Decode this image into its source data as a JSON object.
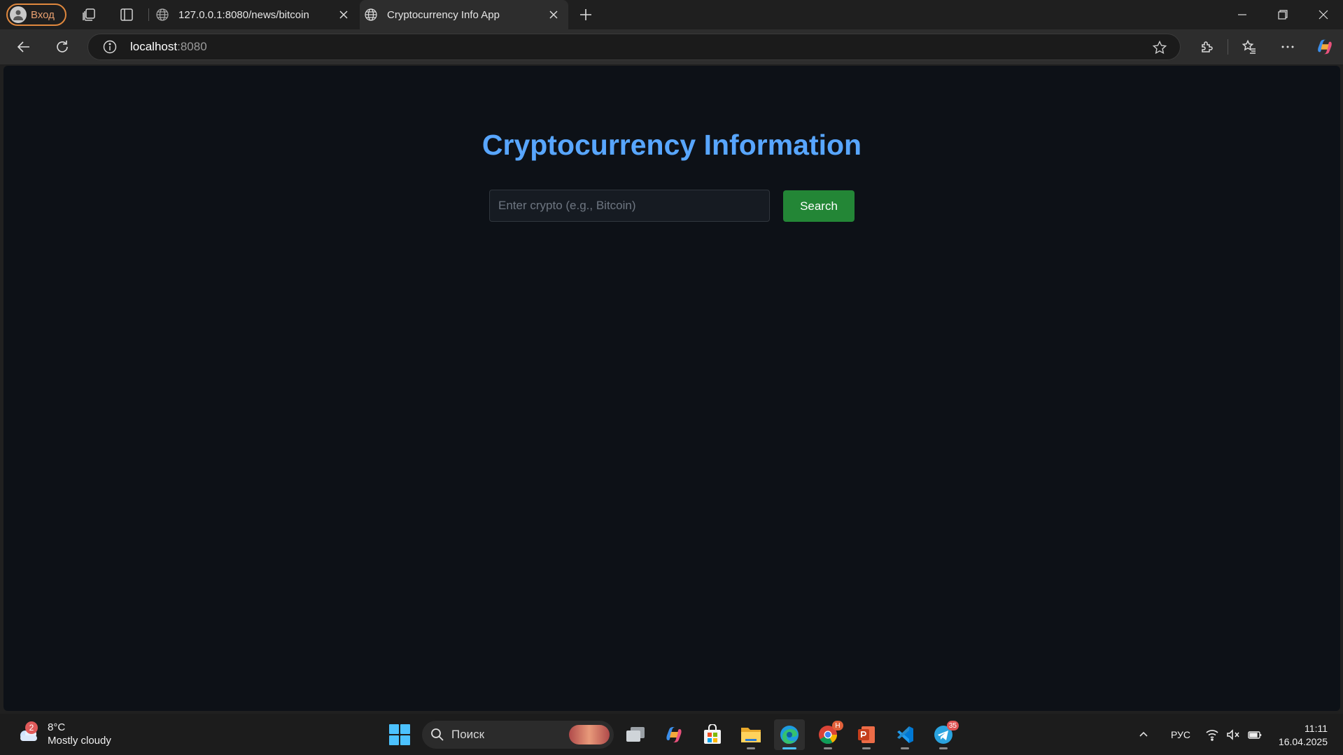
{
  "browser": {
    "profile_label": "Вход",
    "tabs": [
      {
        "title": "127.0.0.1:8080/news/bitcoin",
        "active": false
      },
      {
        "title": "Cryptocurrency Info App",
        "active": true
      }
    ],
    "address": {
      "host": "localhost",
      "port": ":8080"
    }
  },
  "page": {
    "title": "Cryptocurrency Information",
    "search_placeholder": "Enter crypto (e.g., Bitcoin)",
    "search_button": "Search",
    "colors": {
      "background": "#0d1117",
      "title": "#58a6ff",
      "button": "#238636"
    }
  },
  "taskbar": {
    "weather": {
      "badge": "2",
      "temp": "8°C",
      "condition": "Mostly cloudy"
    },
    "search_label": "Поиск",
    "apps": [
      {
        "name": "task-view",
        "icon": "task-view-icon"
      },
      {
        "name": "copilot",
        "icon": "copilot-icon"
      },
      {
        "name": "microsoft-store",
        "icon": "store-icon"
      },
      {
        "name": "file-explorer",
        "icon": "folder-icon"
      },
      {
        "name": "edge",
        "icon": "edge-icon"
      },
      {
        "name": "chrome",
        "icon": "chrome-icon",
        "badge": "H"
      },
      {
        "name": "powerpoint",
        "icon": "powerpoint-icon"
      },
      {
        "name": "vscode",
        "icon": "vscode-icon"
      },
      {
        "name": "telegram",
        "icon": "telegram-icon",
        "badge": "35"
      }
    ],
    "tray": {
      "language": "РУС"
    },
    "clock": {
      "time": "11:11",
      "date": "16.04.2025"
    }
  }
}
